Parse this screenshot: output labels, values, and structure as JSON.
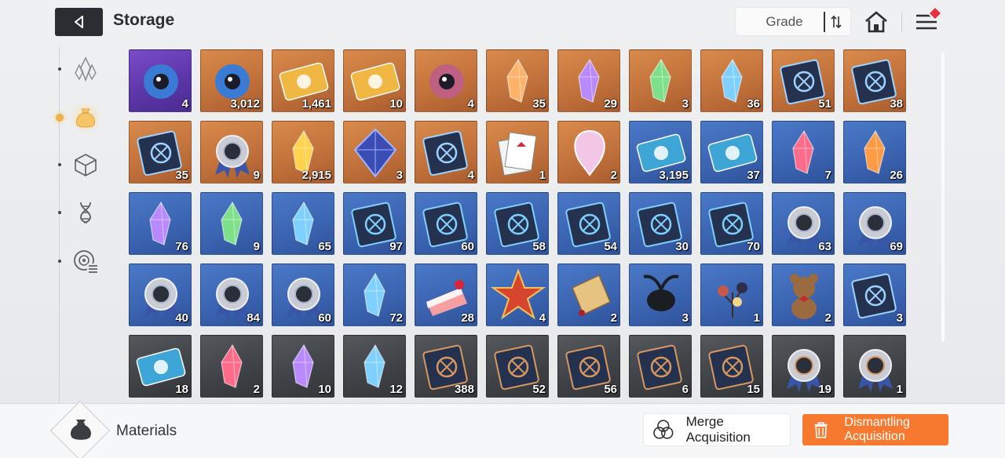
{
  "header": {
    "title": "Storage",
    "sort_label": "Grade"
  },
  "sidebar": {
    "categories": [
      {
        "name": "crystal",
        "active": false
      },
      {
        "name": "materials",
        "active": true
      },
      {
        "name": "cube",
        "active": false
      },
      {
        "name": "dna",
        "active": false
      },
      {
        "name": "radar",
        "active": false
      }
    ]
  },
  "colors": {
    "purple_rarity": "#5a35a6",
    "orange_rarity": "#c0703a",
    "blue_rarity": "#3a63b0",
    "gray_rarity": "#3e4145",
    "accent_orange": "#f7792f"
  },
  "items": [
    {
      "icon": "eye-card-icon",
      "rarity": "purple",
      "count": "4"
    },
    {
      "icon": "eye-orb-icon",
      "rarity": "orange",
      "count": "3,012"
    },
    {
      "icon": "gold-ticket-icon",
      "rarity": "orange",
      "count": "1,461"
    },
    {
      "icon": "compass-ticket-icon",
      "rarity": "orange",
      "count": "10"
    },
    {
      "icon": "flesh-eye-icon",
      "rarity": "orange",
      "count": "4"
    },
    {
      "icon": "rainbow-crystal-icon",
      "rarity": "orange",
      "count": "35"
    },
    {
      "icon": "purple-crystal-icon",
      "rarity": "orange",
      "count": "29"
    },
    {
      "icon": "green-crystal-icon",
      "rarity": "orange",
      "count": "3"
    },
    {
      "icon": "blue-crystal-icon",
      "rarity": "orange",
      "count": "36"
    },
    {
      "icon": "sword-book-icon",
      "rarity": "orange",
      "count": "51"
    },
    {
      "icon": "shield-book-icon",
      "rarity": "orange",
      "count": "38"
    },
    {
      "icon": "butterfly-book-icon",
      "rarity": "orange",
      "count": "35"
    },
    {
      "icon": "medal-icon",
      "rarity": "orange",
      "count": "9"
    },
    {
      "icon": "gold-shards-icon",
      "rarity": "orange",
      "count": "2,915"
    },
    {
      "icon": "prism-icon",
      "rarity": "orange",
      "count": "3"
    },
    {
      "icon": "star-map-book-icon",
      "rarity": "orange",
      "count": "4"
    },
    {
      "icon": "cards-icon",
      "rarity": "orange",
      "count": "1"
    },
    {
      "icon": "opal-pick-icon",
      "rarity": "orange",
      "count": "2"
    },
    {
      "icon": "profile-ticket-icon",
      "rarity": "blue",
      "count": "3,195"
    },
    {
      "icon": "compass-ticket-blue-icon",
      "rarity": "blue",
      "count": "37"
    },
    {
      "icon": "red-crystal-icon",
      "rarity": "blue",
      "count": "7"
    },
    {
      "icon": "amber-crystal-icon",
      "rarity": "blue",
      "count": "26"
    },
    {
      "icon": "violet-shard-icon",
      "rarity": "blue",
      "count": "76"
    },
    {
      "icon": "green-shard-icon",
      "rarity": "blue",
      "count": "9"
    },
    {
      "icon": "cyan-shard-icon",
      "rarity": "blue",
      "count": "65"
    },
    {
      "icon": "sword-book-blue-icon",
      "rarity": "blue",
      "count": "97"
    },
    {
      "icon": "shield-book-blue-icon",
      "rarity": "blue",
      "count": "60"
    },
    {
      "icon": "eye-book-blue-icon",
      "rarity": "blue",
      "count": "58"
    },
    {
      "icon": "butterfly-book-blue-icon",
      "rarity": "blue",
      "count": "54"
    },
    {
      "icon": "cross-book-blue-icon",
      "rarity": "blue",
      "count": "30"
    },
    {
      "icon": "globe-book-blue-icon",
      "rarity": "blue",
      "count": "70"
    },
    {
      "icon": "sword-medal-icon",
      "rarity": "blue",
      "count": "63"
    },
    {
      "icon": "cross-medal-icon",
      "rarity": "blue",
      "count": "69"
    },
    {
      "icon": "eye-medal-icon",
      "rarity": "blue",
      "count": "40"
    },
    {
      "icon": "bolt-medal-icon",
      "rarity": "blue",
      "count": "84"
    },
    {
      "icon": "globe-medal-icon",
      "rarity": "blue",
      "count": "60"
    },
    {
      "icon": "ice-crystal-icon",
      "rarity": "blue",
      "count": "72"
    },
    {
      "icon": "cake-icon",
      "rarity": "blue",
      "count": "28"
    },
    {
      "icon": "star-badge-icon",
      "rarity": "blue",
      "count": "4"
    },
    {
      "icon": "tag-icon",
      "rarity": "blue",
      "count": "2"
    },
    {
      "icon": "beetle-icon",
      "rarity": "blue",
      "count": "3"
    },
    {
      "icon": "flowers-icon",
      "rarity": "blue",
      "count": "1"
    },
    {
      "icon": "teddy-bear-icon",
      "rarity": "blue",
      "count": "2"
    },
    {
      "icon": "emblem-book-icon",
      "rarity": "blue",
      "count": "3"
    },
    {
      "icon": "profile-ticket-gray-icon",
      "rarity": "dark",
      "count": "18"
    },
    {
      "icon": "pink-shard-icon",
      "rarity": "dark",
      "count": "2"
    },
    {
      "icon": "purple-shard-icon",
      "rarity": "dark",
      "count": "10"
    },
    {
      "icon": "blue-shard-icon",
      "rarity": "dark",
      "count": "12"
    },
    {
      "icon": "sword-book-bronze-icon",
      "rarity": "dark",
      "count": "388"
    },
    {
      "icon": "shield-book-bronze-icon",
      "rarity": "dark",
      "count": "52"
    },
    {
      "icon": "eye-book-bronze-icon",
      "rarity": "dark",
      "count": "56"
    },
    {
      "icon": "butterfly-book-bronze-icon",
      "rarity": "dark",
      "count": "6"
    },
    {
      "icon": "globe-book-bronze-icon",
      "rarity": "dark",
      "count": "15"
    },
    {
      "icon": "cross-medal-bronze-icon",
      "rarity": "dark",
      "count": "19"
    },
    {
      "icon": "sword-medal-bronze-icon",
      "rarity": "dark",
      "count": "1"
    }
  ],
  "footer": {
    "category_label": "Materials",
    "merge_label": "Merge Acquisition",
    "dismantle_label": "Dismantling Acquisition"
  }
}
